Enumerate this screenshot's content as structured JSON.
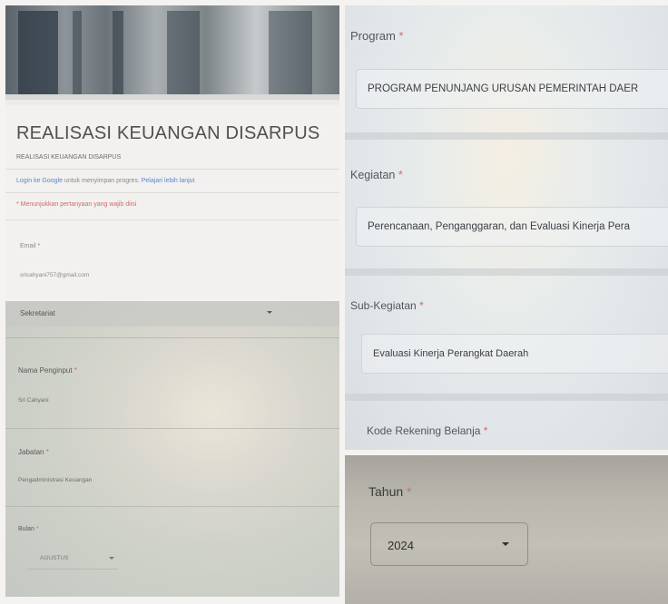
{
  "form_header": {
    "title": "REALISASI KEUANGAN DISARPUS",
    "description": "REALISASI KEUANGAN DISARPUS",
    "login_link": "Login ke Google",
    "login_text": " untuk menyimpan progres. ",
    "learn_more": "Pelajari lebih lanjut",
    "required_note": "* Menunjukkan pertanyaan yang wajib diisi"
  },
  "email": {
    "label": "Email",
    "required_mark": "*",
    "value": "sricahyani757@gmail.com"
  },
  "unit": {
    "selected": "Sekretariat"
  },
  "nama_penginput": {
    "label": "Nama Penginput",
    "required_mark": "*",
    "value": "Sri Cahyani"
  },
  "jabatan": {
    "label": "Jabatan",
    "required_mark": "*",
    "value": "Pengadministrasi Keuangan"
  },
  "bulan": {
    "label": "Bulan",
    "required_mark": "*",
    "selected": "AGUSTUS"
  },
  "program": {
    "label": "Program",
    "required_mark": "*",
    "value": "PROGRAM PENUNJANG URUSAN PEMERINTAH DAER"
  },
  "kegiatan": {
    "label": "Kegiatan",
    "required_mark": "*",
    "value": "Perencanaan, Penganggaran, dan Evaluasi Kinerja Pera"
  },
  "sub_kegiatan": {
    "label": "Sub-Kegiatan",
    "required_mark": "*",
    "value": "Evaluasi Kinerja Perangkat Daerah"
  },
  "kode_rekening": {
    "label": "Kode Rekening Belanja",
    "required_mark": "*"
  },
  "tahun": {
    "label": "Tahun",
    "required_mark": "*",
    "selected": "2024"
  },
  "colors": {
    "required": "#d16a6a",
    "link": "#5b86c9"
  }
}
